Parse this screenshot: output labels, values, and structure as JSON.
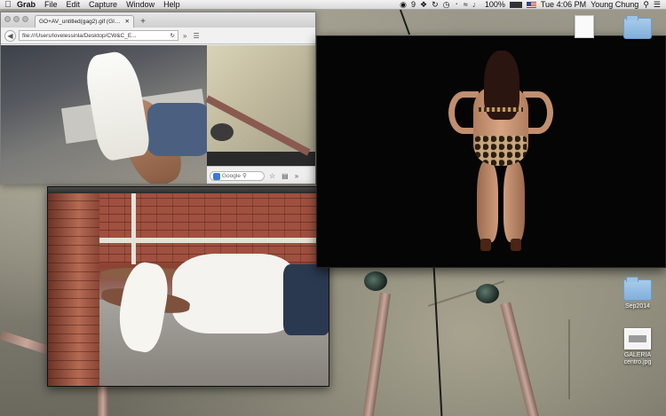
{
  "menubar": {
    "app_name": "Grab",
    "items": [
      "File",
      "Edit",
      "Capture",
      "Window",
      "Help"
    ],
    "status": {
      "notification_count": "9",
      "battery_percent": "100%",
      "datetime": "Tue 4:06 PM",
      "user": "Young Chung"
    }
  },
  "browser": {
    "tab_title": "GO+AV_untitled(gag2).gif (GIF...",
    "tab_close": "✕",
    "new_tab": "+",
    "url": "file:///Users/lovelessinla/Desktop/CW&C_E...",
    "search_placeholder": "Google"
  },
  "desktop_icons": [
    {
      "label": "Sep2014",
      "type": "folder"
    },
    {
      "label": "GALERIA\ncentro.jpg",
      "type": "image"
    }
  ],
  "colors": {
    "menubar_bg": "#e6e6e6",
    "preview_bg": "#050505",
    "folder_blue": "#7fb0dc"
  }
}
